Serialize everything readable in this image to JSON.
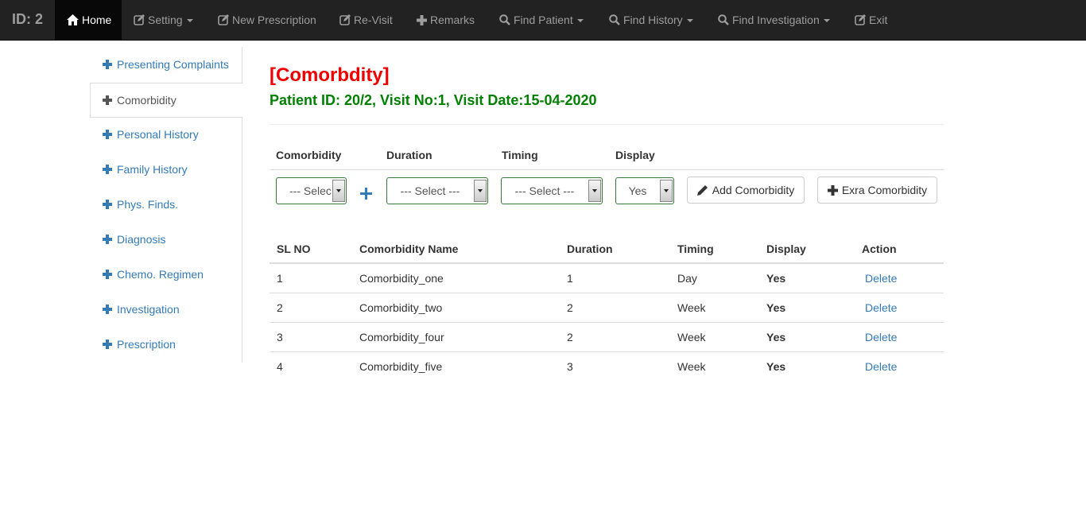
{
  "navbar": {
    "brand": "ID: 2",
    "items": [
      {
        "label": "Home",
        "icon": "home-icon"
      },
      {
        "label": "Setting",
        "icon": "edit-icon",
        "caret": true
      },
      {
        "label": "New Prescription",
        "icon": "edit-icon"
      },
      {
        "label": "Re-Visit",
        "icon": "edit-icon"
      },
      {
        "label": "Remarks",
        "icon": "plus-icon"
      },
      {
        "label": "Find Patient",
        "icon": "search-icon",
        "caret": true
      },
      {
        "label": "Find History",
        "icon": "search-icon",
        "caret": true
      },
      {
        "label": "Find Investigation",
        "icon": "search-icon",
        "caret": true
      },
      {
        "label": "Exit",
        "icon": "edit-icon"
      }
    ]
  },
  "sidebar": {
    "items": [
      {
        "label": "Presenting Complaints"
      },
      {
        "label": "Comorbidity"
      },
      {
        "label": "Personal History"
      },
      {
        "label": "Family History"
      },
      {
        "label": "Phys. Finds."
      },
      {
        "label": "Diagnosis"
      },
      {
        "label": "Chemo. Regimen"
      },
      {
        "label": "Investigation"
      },
      {
        "label": "Prescription"
      }
    ]
  },
  "main": {
    "title": "[Comorbdity]",
    "subtitle": "Patient ID: 20/2,  Visit No:1, Visit Date:15-04-2020"
  },
  "form": {
    "headers": {
      "comorbidity": "Comorbidity",
      "duration": "Duration",
      "timing": "Timing",
      "display": "Display"
    },
    "comorbidity_value": "--- Select ---",
    "duration_value": "--- Select ---",
    "timing_value": "--- Select ---",
    "display_value": "Yes",
    "add_button": "Add Comorbidity",
    "extra_button": "Exra Comorbidity"
  },
  "table": {
    "headers": {
      "sl": "SL NO",
      "name": "Comorbidity Name",
      "duration": "Duration",
      "timing": "Timing",
      "display": "Display",
      "action": "Action"
    },
    "rows": [
      {
        "sl": "1",
        "name": "Comorbidity_one",
        "duration": "1",
        "timing": "Day",
        "display": "Yes",
        "action": "Delete"
      },
      {
        "sl": "2",
        "name": "Comorbidity_two",
        "duration": "2",
        "timing": "Week",
        "display": "Yes",
        "action": "Delete"
      },
      {
        "sl": "3",
        "name": "Comorbidity_four",
        "duration": "2",
        "timing": "Week",
        "display": "Yes",
        "action": "Delete"
      },
      {
        "sl": "4",
        "name": "Comorbidity_five",
        "duration": "3",
        "timing": "Week",
        "display": "Yes",
        "action": "Delete"
      }
    ]
  },
  "colors": {
    "navbar_bg": "#222222",
    "link": "#337ab7",
    "title": "#ee0000",
    "subtitle": "#008000"
  }
}
